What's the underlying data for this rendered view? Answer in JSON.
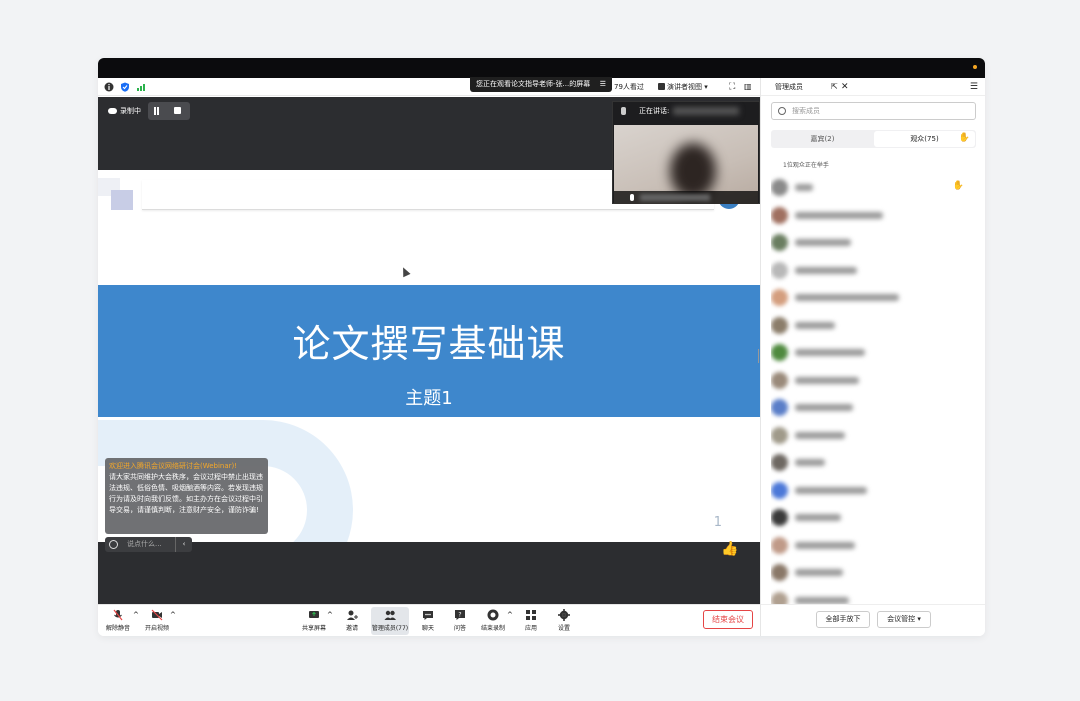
{
  "window": {
    "sharing_banner": "您正在观看论文指导老师-张...的屏幕",
    "viewers": "79人看过",
    "presenter_view": "演讲者视图",
    "recording_label": "录制中"
  },
  "slide": {
    "title": "论文撰写基础课",
    "subtitle": "主题1",
    "page_number": "1"
  },
  "speaker": {
    "label": "正在讲话:"
  },
  "notice": {
    "highlight": "欢迎进入腾讯会议网络研讨会(Webinar)!",
    "body": "请大家共同维护大会秩序，会议过程中禁止出现违法违规、低俗色情、吸烟酗酒等内容。若发现违规行为请及时向我们反馈。如主办方在会议过程中引导交易，请谨慎判断，注意财产安全，谨防诈骗!"
  },
  "chat_input": {
    "placeholder": "说点什么..."
  },
  "bottom_toolbar": {
    "unmute": "解除静音",
    "start_video": "开启视频",
    "share_screen": "共享屏幕",
    "invite": "邀请",
    "manage_members": "管理成员(77)",
    "chat": "聊天",
    "qa": "问答",
    "end_recording": "结束录制",
    "apps": "应用",
    "settings": "设置",
    "end_meeting": "结束会议"
  },
  "panel": {
    "title": "管理成员",
    "search_placeholder": "搜索成员",
    "tab_guests": "嘉宾(2)",
    "tab_audience": "观众(75)",
    "raising_hand": "1位观众正在举手",
    "lower_all": "全部手放下",
    "meeting_control": "会议管控"
  },
  "colors": {
    "accent_blue": "#3e87cc",
    "end_red": "#e54545",
    "hand_yellow": "#f5c242"
  }
}
